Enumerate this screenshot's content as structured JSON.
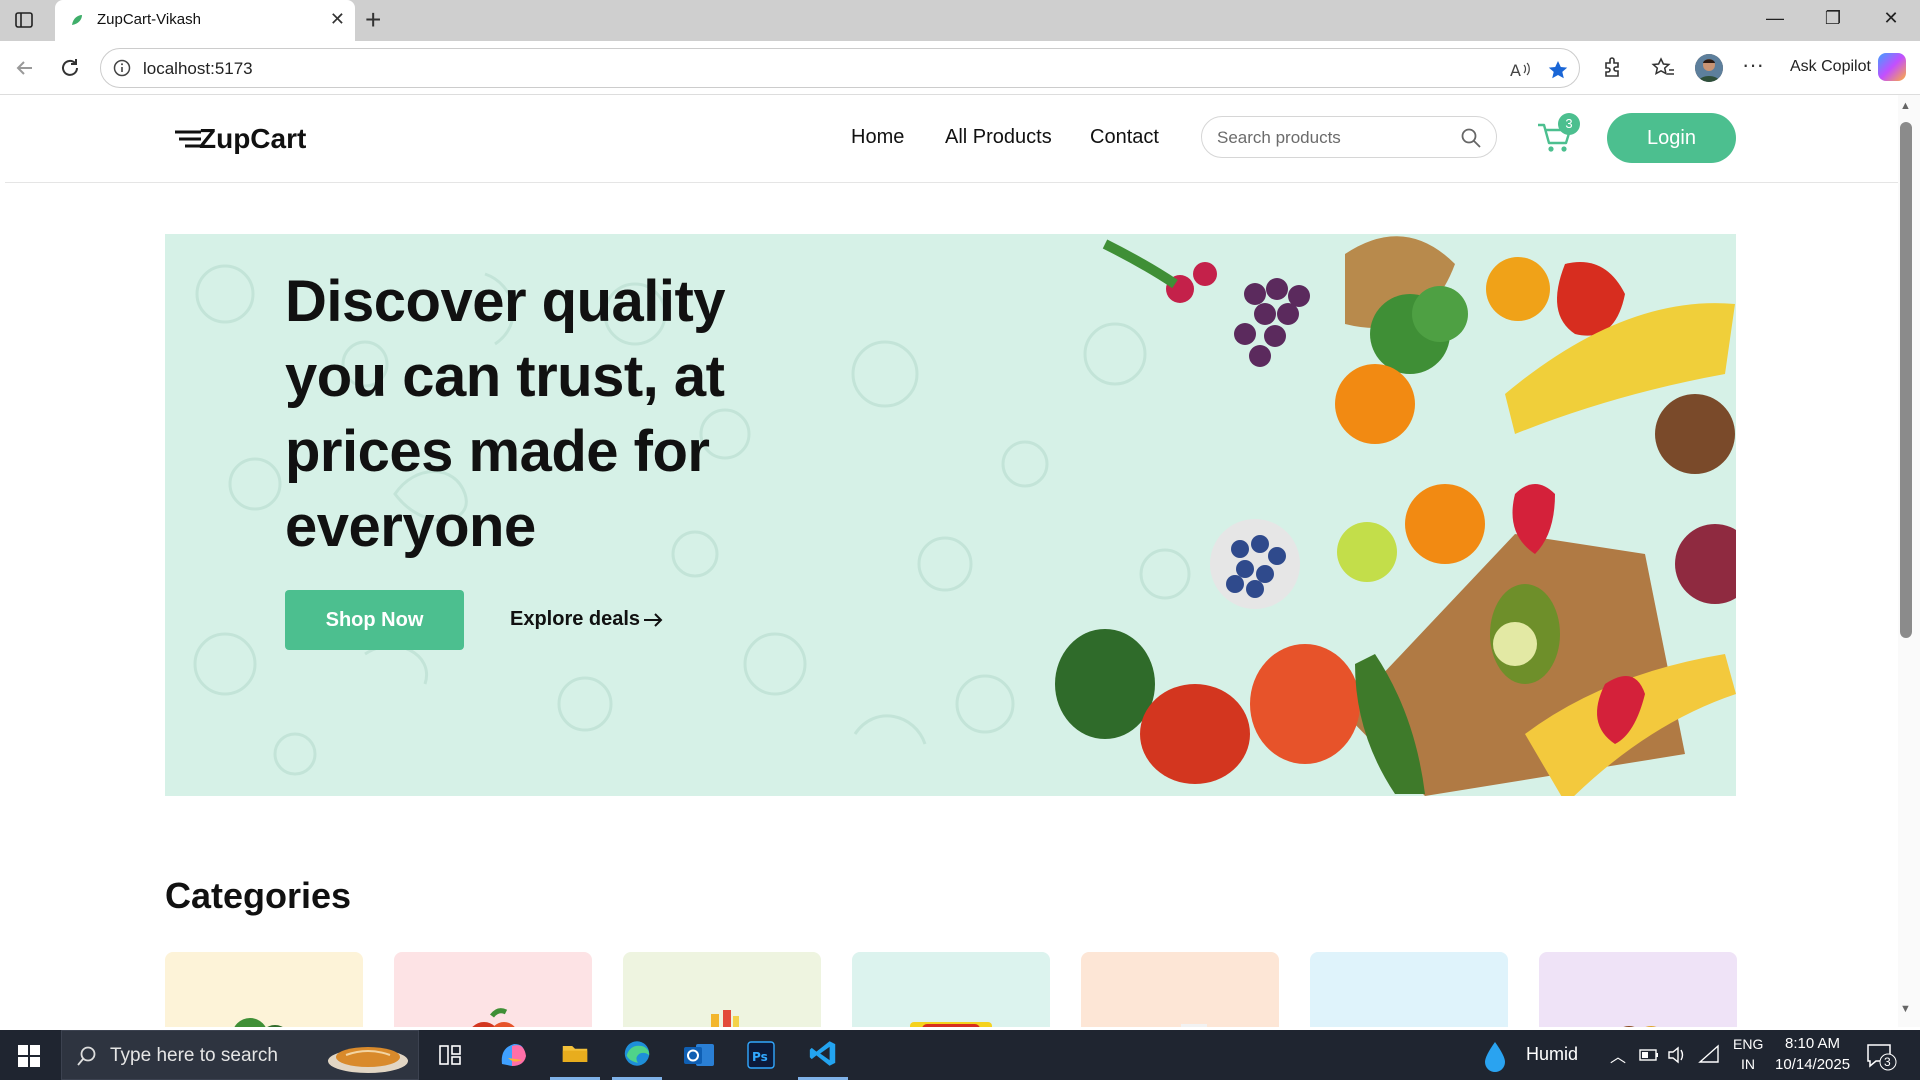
{
  "browser": {
    "tab_title": "ZupCart-Vikash",
    "url": "localhost:5173",
    "copilot_label": "Ask Copilot"
  },
  "site": {
    "logo_text": "ZupCart",
    "nav": [
      "Home",
      "All Products",
      "Contact"
    ],
    "search_placeholder": "Search products",
    "cart_count": "3",
    "login_label": "Login",
    "brand_color": "#4cbf8f"
  },
  "hero": {
    "title_lines": [
      "Discover quality",
      "you can trust, at",
      "prices made for",
      "everyone"
    ],
    "shop_label": "Shop Now",
    "explore_label": "Explore deals",
    "bg_color": "#d6f1e7"
  },
  "categories": {
    "title": "Categories",
    "card_colors": [
      "#fdf3d8",
      "#fde3e5",
      "#eef4e0",
      "#dcf3ee",
      "#fde6d6",
      "#dff3fb",
      "#efe3f7"
    ]
  },
  "taskbar": {
    "search_placeholder": "Type here to search",
    "weather": "Humid",
    "lang1": "ENG",
    "lang2": "IN",
    "time": "8:10 AM",
    "date": "10/14/2025",
    "notif_count": "3"
  }
}
